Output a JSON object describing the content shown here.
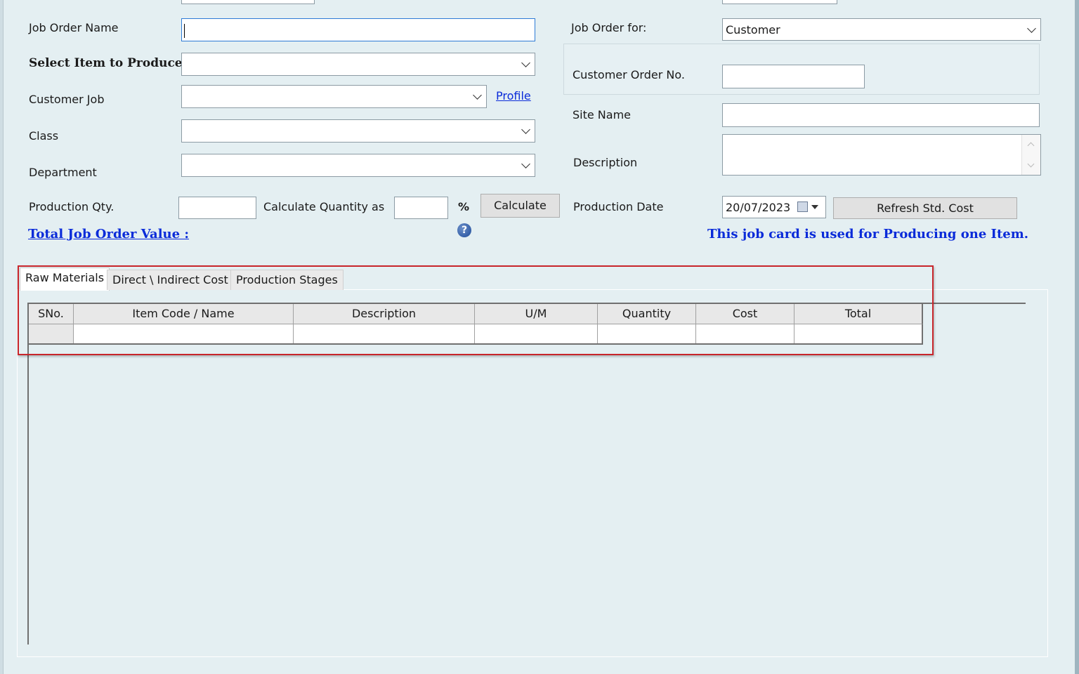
{
  "form_left": {
    "job_order_name_label": "Job Order Name",
    "job_order_name_value": "",
    "select_item_label": "Select Item to Produce",
    "customer_job_label": "Customer Job",
    "profile_link": "Profile",
    "class_label": "Class",
    "department_label": "Department",
    "production_qty_label": "Production Qty.",
    "calc_qty_label": "Calculate Quantity as",
    "percent_sign": "%",
    "calculate_button": "Calculate",
    "total_value_label": "Total Job Order Value :"
  },
  "form_right": {
    "job_order_for_label": "Job Order for:",
    "job_order_for_value": "Customer",
    "customer_order_label": "Customer Order No.",
    "site_name_label": "Site Name",
    "description_label": "Description",
    "production_date_label": "Production Date",
    "production_date_value": "20/07/2023",
    "refresh_button": "Refresh Std. Cost",
    "info_text": "This job card is used for Producing one Item."
  },
  "tabs": [
    {
      "label": "Raw Materials",
      "active": true
    },
    {
      "label": "Direct \\ Indirect Cost",
      "active": false
    },
    {
      "label": "Production Stages",
      "active": false
    }
  ],
  "grid": {
    "columns": [
      "SNo.",
      "Item Code / Name",
      "Description",
      "U/M",
      "Quantity",
      "Cost",
      "Total"
    ]
  },
  "colors": {
    "background": "#e4eff2",
    "link_blue": "#0a2bd9",
    "highlight_red": "#c8252b"
  }
}
